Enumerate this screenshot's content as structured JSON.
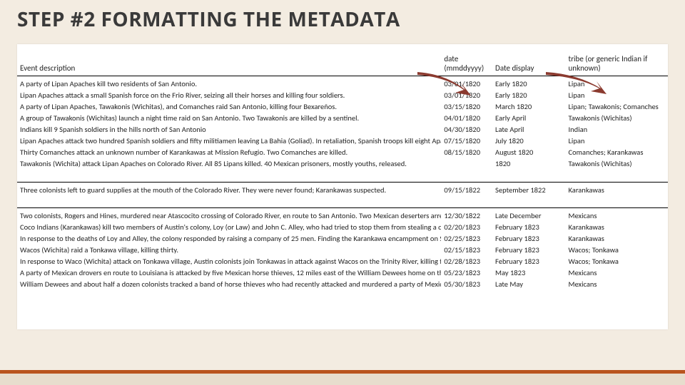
{
  "title": "STEP #2 FORMATTING THE METADATA",
  "chart_data": {
    "type": "table",
    "headers": {
      "desc": "Event description",
      "date": "date (mmddyyyy)",
      "disp": "Date display",
      "tribe": "tribe (or generic Indian if unknown)"
    },
    "rows": [
      {
        "desc": "A party of Lipan Apaches kill two residents of San Antonio.",
        "date": "03/01/1820",
        "disp": "Early 1820",
        "tribe": "Lipan"
      },
      {
        "desc": "Lipan Apaches attack a small Spanish force on the Frio River, seizing all their horses and killing four soldiers.",
        "date": "03/01/1820",
        "disp": "Early 1820",
        "tribe": "Lipan"
      },
      {
        "desc": "A party of Lipan Apaches, Tawakonis (Wichitas), and Comanches raid San Antonio, killing four Bexareños.",
        "date": "03/15/1820",
        "disp": "March 1820",
        "tribe": "Lipan; Tawakonis; Comanches"
      },
      {
        "desc": "A group of Tawakonis (Wichitas) launch a night time raid on San Antonio. Two Tawakonis are killed by a sentinel.",
        "date": "04/01/1820",
        "disp": "Early April",
        "tribe": "Tawakonis (Wichitas)"
      },
      {
        "desc": "Indians kill 9 Spanish soldiers in the hills north of San Antonio",
        "date": "04/30/1820",
        "disp": "Late April",
        "tribe": "Indian"
      },
      {
        "desc": "Lipan Apaches attack two hundred Spanish soldiers and fifty militiamen leaving La Bahia (Goliad). In retaliation, Spanish troops kill eight Apaches in their rancheria.",
        "date": "07/15/1820",
        "disp": "July 1820",
        "tribe": "Lipan"
      },
      {
        "desc": "Thirty Comanches attack an unknown number of Karankawas at Mission Refugio. Two Comanches are killed.",
        "date": "08/15/1820",
        "disp": "August 1820",
        "tribe": "Comanches; Karankawas"
      },
      {
        "desc": "Tawakonis (Wichita) attack Lipan Apaches on Colorado River. All 85 Lipans killed. 40 Mexican prisoners, mostly youths, released.",
        "date": "",
        "disp": "1820",
        "tribe": "Tawakonis (Wichitas)"
      }
    ],
    "rows2": [
      {
        "desc": "Three colonists left to guard supplies at the mouth of the Colorado River. They were never found; Karankawas suspected.",
        "date": "09/15/1822",
        "disp": "September 1822",
        "tribe": "Karankawas"
      }
    ],
    "rows3": [
      {
        "desc": "Two colonists, Rogers and Hines, murdered near Atascocito crossing of Colorado River, en route to San Antonio. Two Mexican deserters arrested for the murders.",
        "date": "12/30/1822",
        "disp": "Late December",
        "tribe": "Mexicans"
      },
      {
        "desc": "Coco Indians (Karankawas) kill two members of Austin's colony, Loy (or Law) and John C. Alley, who had tried to stop them from stealing a corn-filled canoe.",
        "date": "02/20/1823",
        "disp": "February 1823",
        "tribe": "Karankawas"
      },
      {
        "desc": "In response to the deaths of Loy and Alley, the colony responded by raising a company of 25 men. Finding the Karankawa encampment on Skull Creek, they killed nineteen.",
        "date": "02/25/1823",
        "disp": "February 1823",
        "tribe": "Karankawas"
      },
      {
        "desc": "Wacos (Wichita) raid a Tonkawa village, killing thirty.",
        "date": "02/15/1823",
        "disp": "February 1823",
        "tribe": "Wacos; Tonkawa"
      },
      {
        "desc": "In response to Waco (Wichita) attack on Tonkawa village, Austin colonists join Tonkawas in attack against Wacos on the Trinity River, killing forty Wacos.",
        "date": "02/28/1823",
        "disp": "February 1823",
        "tribe": "Wacos; Tonkawa"
      },
      {
        "desc": "A party of Mexican drovers en route to Louisiana is attacked by five Mexican horse thieves, 12 miles east of the William Dewees home on the lower Colorado.",
        "date": "05/23/1823",
        "disp": "May 1823",
        "tribe": "Mexicans"
      },
      {
        "desc": "William Dewees and about half a dozen colonists tracked a band of horse thieves who had recently attacked and murdered a party of Mexican drovers.",
        "date": "05/30/1823",
        "disp": "Late May",
        "tribe": "Mexicans"
      }
    ]
  }
}
